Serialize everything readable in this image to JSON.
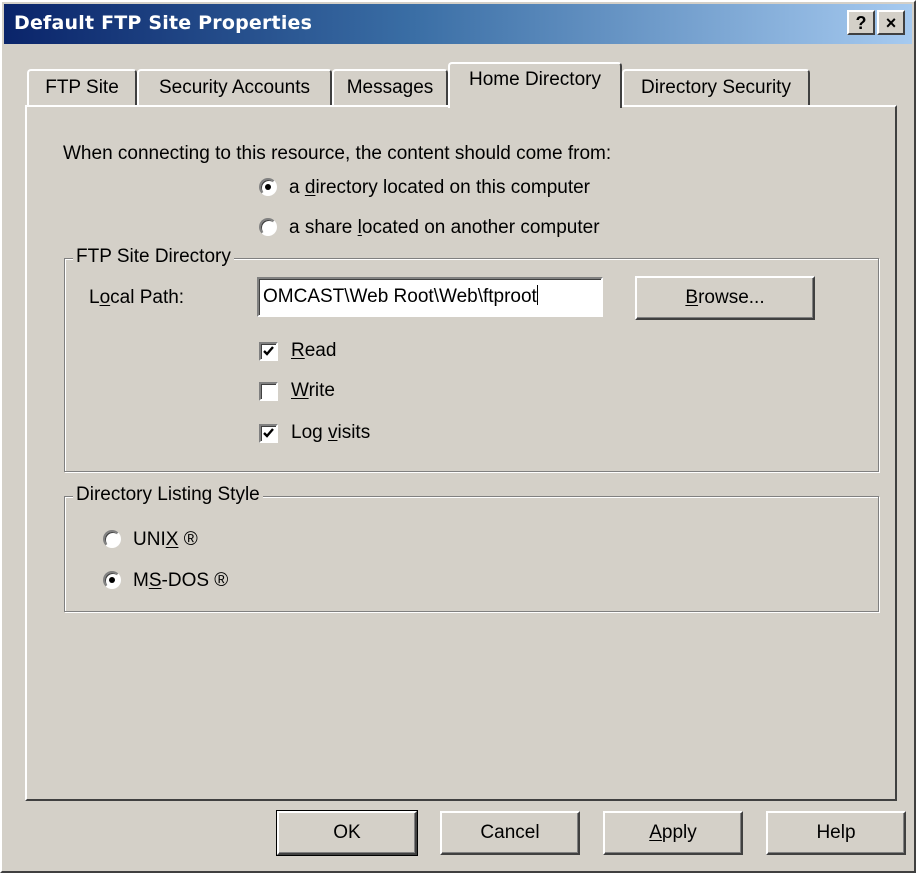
{
  "window": {
    "title": "Default FTP Site Properties",
    "help_btn": "?",
    "close_btn": "×"
  },
  "tabs": [
    {
      "label": "FTP Site",
      "active": false
    },
    {
      "label": "Security Accounts",
      "active": false
    },
    {
      "label": "Messages",
      "active": false
    },
    {
      "label": "Home Directory",
      "active": true
    },
    {
      "label": "Directory Security",
      "active": false
    }
  ],
  "content_source": {
    "prompt": "When connecting to this resource, the content should come from:",
    "options": [
      {
        "label_pre": "a ",
        "label_mn": "d",
        "label_post": "irectory located on this computer",
        "selected": true
      },
      {
        "label_pre": "a share ",
        "label_mn": "l",
        "label_post": "ocated on another computer",
        "selected": false
      }
    ]
  },
  "ftp_site_directory": {
    "group_label": "FTP Site Directory",
    "local_path_label_pre": "L",
    "local_path_label_mn": "o",
    "local_path_label_post": "cal Path:",
    "local_path_value": "OMCAST\\Web Root\\Web\\ftproot",
    "browse_pre": "",
    "browse_mn": "B",
    "browse_post": "rowse...",
    "checkboxes": [
      {
        "pre": "",
        "mn": "R",
        "post": "ead",
        "checked": true
      },
      {
        "pre": "",
        "mn": "W",
        "post": "rite",
        "checked": false
      },
      {
        "pre": "Log ",
        "mn": "v",
        "post": "isits",
        "checked": true
      }
    ]
  },
  "listing_style": {
    "group_label": "Directory Listing Style",
    "options": [
      {
        "pre": "UNI",
        "mn": "X",
        "post": " ®",
        "selected": false
      },
      {
        "pre": "M",
        "mn": "S",
        "post": "-DOS ®",
        "selected": true
      }
    ]
  },
  "buttons": {
    "ok": "OK",
    "cancel": "Cancel",
    "apply_mn": "A",
    "apply_post": "pply",
    "help": "Help"
  }
}
